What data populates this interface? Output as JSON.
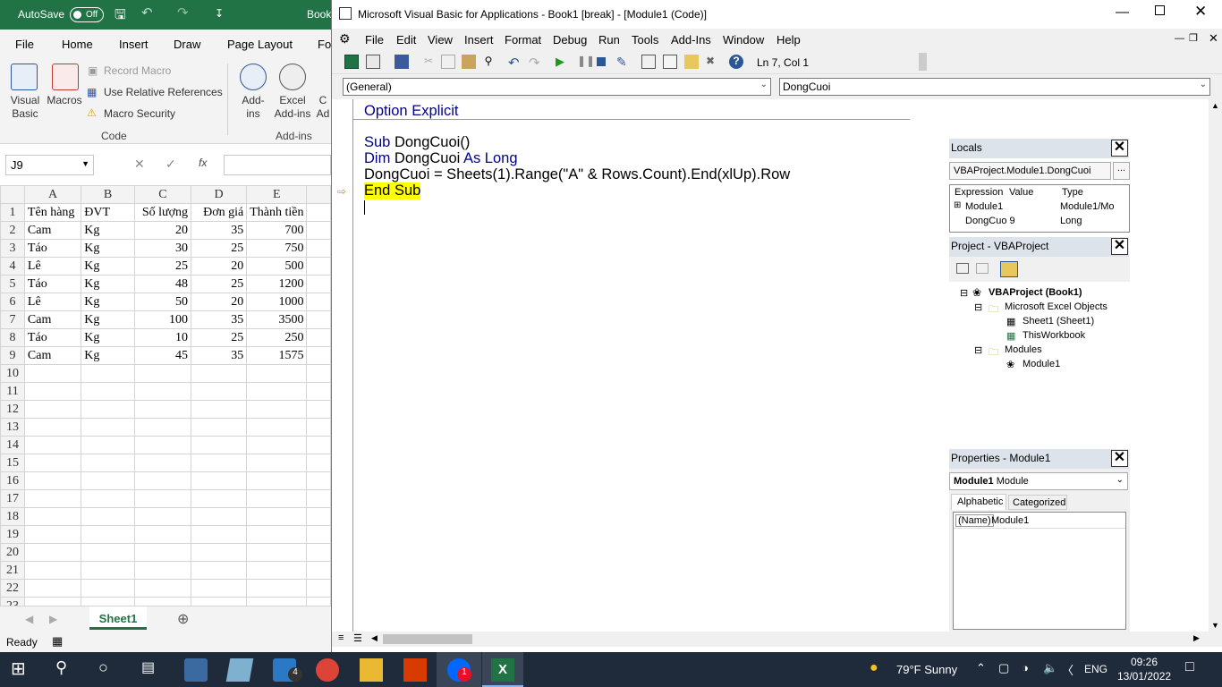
{
  "excel": {
    "autosave_label": "AutoSave",
    "autosave_state": "Off",
    "title_fragment": "Book",
    "tabs": [
      "File",
      "Home",
      "Insert",
      "Draw",
      "Page Layout",
      "Fo"
    ],
    "ribbon": {
      "visual_basic": "Visual Basic",
      "macros": "Macros",
      "record_macro": "Record Macro",
      "relative_refs": "Use Relative References",
      "macro_security": "Macro Security",
      "code_group": "Code",
      "addins": "Add-ins",
      "excel_addins": "Excel Add-ins",
      "addins_group": "Add-ins",
      "com_fragment": "C Ad"
    },
    "name_box": "J9",
    "formula_fx": "fx",
    "columns": [
      "A",
      "B",
      "C",
      "D",
      "E"
    ],
    "rows": [
      [
        "1",
        "Tên hàng",
        "ĐVT",
        "Số lượng",
        "Đơn giá",
        "Thành tiền"
      ],
      [
        "2",
        "Cam",
        "Kg",
        "20",
        "35",
        "700"
      ],
      [
        "3",
        "Táo",
        "Kg",
        "30",
        "25",
        "750"
      ],
      [
        "4",
        "Lê",
        "Kg",
        "25",
        "20",
        "500"
      ],
      [
        "5",
        "Táo",
        "Kg",
        "48",
        "25",
        "1200"
      ],
      [
        "6",
        "Lê",
        "Kg",
        "50",
        "20",
        "1000"
      ],
      [
        "7",
        "Cam",
        "Kg",
        "100",
        "35",
        "3500"
      ],
      [
        "8",
        "Táo",
        "Kg",
        "10",
        "25",
        "250"
      ],
      [
        "9",
        "Cam",
        "Kg",
        "45",
        "35",
        "1575"
      ],
      [
        "10",
        "",
        "",
        "",
        "",
        ""
      ],
      [
        "11",
        "",
        "",
        "",
        "",
        ""
      ],
      [
        "12",
        "",
        "",
        "",
        "",
        ""
      ],
      [
        "13",
        "",
        "",
        "",
        "",
        ""
      ],
      [
        "14",
        "",
        "",
        "",
        "",
        ""
      ],
      [
        "15",
        "",
        "",
        "",
        "",
        ""
      ],
      [
        "16",
        "",
        "",
        "",
        "",
        ""
      ],
      [
        "17",
        "",
        "",
        "",
        "",
        ""
      ],
      [
        "18",
        "",
        "",
        "",
        "",
        ""
      ],
      [
        "19",
        "",
        "",
        "",
        "",
        ""
      ],
      [
        "20",
        "",
        "",
        "",
        "",
        ""
      ],
      [
        "21",
        "",
        "",
        "",
        "",
        ""
      ],
      [
        "22",
        "",
        "",
        "",
        "",
        ""
      ],
      [
        "23",
        "",
        "",
        "",
        "",
        ""
      ]
    ],
    "sheet_tab": "Sheet1",
    "status": "Ready"
  },
  "vba": {
    "title": "Microsoft Visual Basic for Applications - Book1 [break] - [Module1 (Code)]",
    "menu": [
      "File",
      "Edit",
      "View",
      "Insert",
      "Format",
      "Debug",
      "Run",
      "Tools",
      "Add-Ins",
      "Window",
      "Help"
    ],
    "position": "Ln 7, Col 1",
    "object_combo": "(General)",
    "proc_combo": "DongCuoi",
    "code": {
      "line1_kw": "Option Explicit",
      "line2_kw": "Sub",
      "line2_rest": " DongCuoi()",
      "line3_kw1": "Dim",
      "line3_mid": " DongCuoi ",
      "line3_kw2": "As Long",
      "line4": "DongCuoi = Sheets(1).Range(\"A\" & Rows.Count).End(xlUp).Row",
      "line5": "End Sub"
    },
    "locals": {
      "title": "Locals",
      "context": "VBAProject.Module1.DongCuoi",
      "headers": [
        "Expression",
        "Value",
        "Type"
      ],
      "rows": [
        [
          "Module1",
          "",
          "Module1/Mo"
        ],
        [
          "DongCuo 9",
          "",
          "Long"
        ]
      ]
    },
    "project": {
      "title": "Project - VBAProject",
      "root": "VBAProject (Book1)",
      "excel_objects": "Microsoft Excel Objects",
      "sheet1": "Sheet1 (Sheet1)",
      "workbook": "ThisWorkbook",
      "modules": "Modules",
      "module1": "Module1"
    },
    "properties": {
      "title": "Properties - Module1",
      "object_bold": "Module1",
      "object_type": "Module",
      "tab_alpha": "Alphabetic",
      "tab_cat": "Categorized",
      "prop_name": "(Name)",
      "prop_value": "Module1"
    }
  },
  "taskbar": {
    "weather": "79°F  Sunny",
    "lang": "ENG",
    "time": "09:26",
    "date": "13/01/2022",
    "mail_badge": "4",
    "zalo_badge": "1"
  }
}
